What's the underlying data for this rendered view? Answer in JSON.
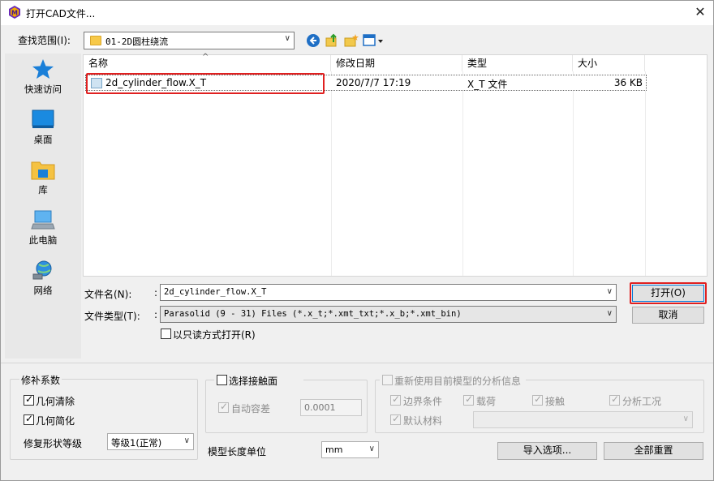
{
  "window": {
    "title": "打开CAD文件..."
  },
  "lookin": {
    "label": "查找范围(I):",
    "value": "01-2D圆柱绕流"
  },
  "places": [
    {
      "label": "快速访问",
      "icon": "star-icon"
    },
    {
      "label": "桌面",
      "icon": "desktop-icon"
    },
    {
      "label": "库",
      "icon": "library-folder-icon"
    },
    {
      "label": "此电脑",
      "icon": "computer-icon"
    },
    {
      "label": "网络",
      "icon": "network-globe-icon"
    }
  ],
  "columns": {
    "name": "名称",
    "modified": "修改日期",
    "type": "类型",
    "size": "大小"
  },
  "files": [
    {
      "name": "2d_cylinder_flow.X_T",
      "modified": "2020/7/7 17:19",
      "type": "X_T 文件",
      "size": "36 KB"
    }
  ],
  "filename": {
    "label": "文件名(N):",
    "value": "2d_cylinder_flow.X_T"
  },
  "filetype": {
    "label": "文件类型(T):",
    "value": "Parasolid (9 - 31) Files (*.x_t;*.xmt_txt;*.x_b;*.xmt_bin)"
  },
  "readonly": {
    "label": "以只读方式打开(R)",
    "checked": false
  },
  "buttons": {
    "open": "打开(O)",
    "cancel": "取消",
    "import_options": "导入选项...",
    "reset_all": "全部重置"
  },
  "repair": {
    "title": "修补系数",
    "geometry_cleanup": {
      "label": "几何清除",
      "checked": true
    },
    "geometry_simplify": {
      "label": "几何简化",
      "checked": true
    },
    "level_label": "修复形状等级",
    "level_value": "等级1(正常)"
  },
  "contact": {
    "title": "选择接触面",
    "title_checked": false,
    "auto_tolerance": {
      "label": "自动容差",
      "checked": true
    },
    "tolerance_value": "0.0001"
  },
  "length_unit": {
    "label": "模型长度单位",
    "value": "mm"
  },
  "reuse": {
    "title": "重新使用目前模型的分析信息",
    "title_checked": false,
    "items": [
      {
        "label": "边界条件",
        "checked": true
      },
      {
        "label": "载荷",
        "checked": true
      },
      {
        "label": "接触",
        "checked": true
      },
      {
        "label": "分析工况",
        "checked": true
      },
      {
        "label": "默认材料",
        "checked": true
      }
    ]
  },
  "colors": {
    "highlight": "#e02020",
    "accent": "#0078d7"
  }
}
